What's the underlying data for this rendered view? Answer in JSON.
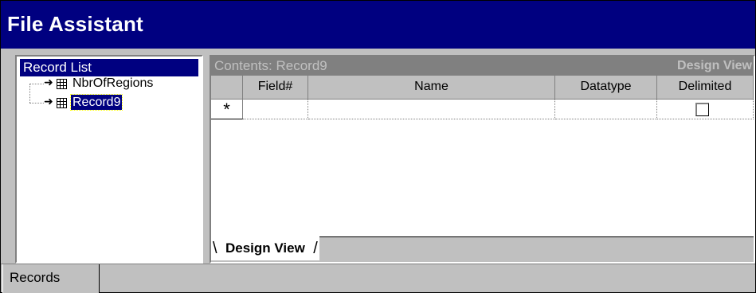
{
  "window": {
    "title": "File Assistant"
  },
  "record_list": {
    "header": "Record List",
    "items": [
      {
        "label": "NbrOfRegions",
        "selected": false
      },
      {
        "label": "Record9",
        "selected": true
      }
    ]
  },
  "contents": {
    "header_label": "Contents: Record9",
    "view_label": "Design View",
    "columns": [
      "Field#",
      "Name",
      "Datatype",
      "Delimited"
    ],
    "new_row_marker": "*",
    "tab_label": "Design View"
  },
  "bottom_tabs": [
    {
      "label": "Records"
    }
  ],
  "colors": {
    "titlebar": "#000080",
    "selection": "#000080",
    "face": "#c0c0c0",
    "shadow": "#808080"
  }
}
